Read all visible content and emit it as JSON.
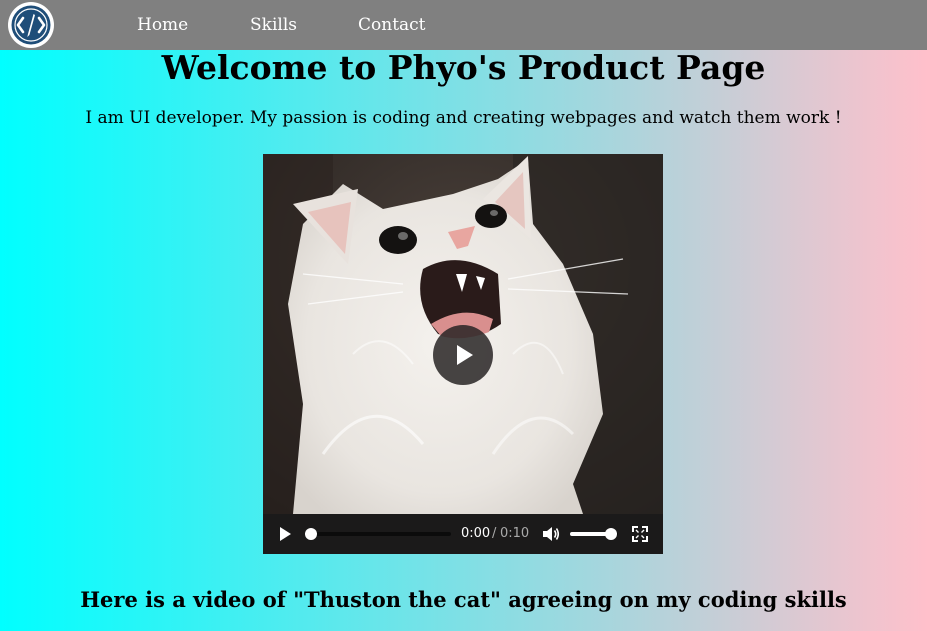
{
  "nav": {
    "items": [
      {
        "label": "Home"
      },
      {
        "label": "Skills"
      },
      {
        "label": "Contact"
      }
    ],
    "logo_icon": "code-pen-icon"
  },
  "header": {
    "title": "Welcome to Phyo's Product Page",
    "intro": "I am UI developer. My passion is coding and creating webpages and watch them work !"
  },
  "video": {
    "time_current": "0:00",
    "time_separator": "/",
    "time_duration": "0:10",
    "progress": 0,
    "volume": 0.85,
    "icons": {
      "big_play": "play-icon",
      "play": "play-icon",
      "mute": "volume-icon",
      "fullscreen": "fullscreen-icon"
    }
  },
  "caption": "Here is a video of \"Thuston the cat\" agreeing on my coding skills",
  "colors": {
    "gradient_start": "#00ffff",
    "gradient_end": "#ffc0cb",
    "navbar": "#808080",
    "logo_ring": "#1f4e79"
  }
}
